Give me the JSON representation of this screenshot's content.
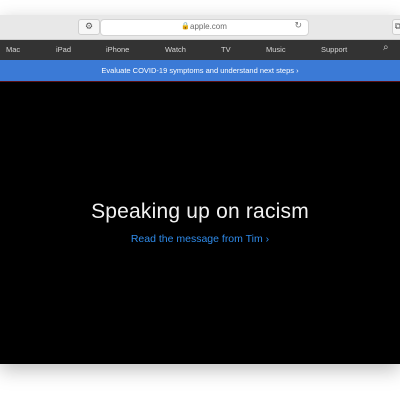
{
  "browser": {
    "url": "apple.com",
    "icons": {
      "lock": "lock-icon",
      "reload": "reload-icon",
      "extension": "extension-icon",
      "tabs": "tabs-icon"
    }
  },
  "nav": {
    "items": [
      "Mac",
      "iPad",
      "iPhone",
      "Watch",
      "TV",
      "Music",
      "Support"
    ],
    "search_icon": "search-icon"
  },
  "banner": {
    "text": "Evaluate COVID-19 symptoms and understand next steps ›"
  },
  "hero": {
    "title": "Speaking up on racism",
    "link": "Read the message from Tim ›"
  },
  "colors": {
    "nav_bg": "#333333",
    "banner_bg": "#3b7ad6",
    "link": "#2f8bea",
    "hero_bg": "#000000"
  }
}
